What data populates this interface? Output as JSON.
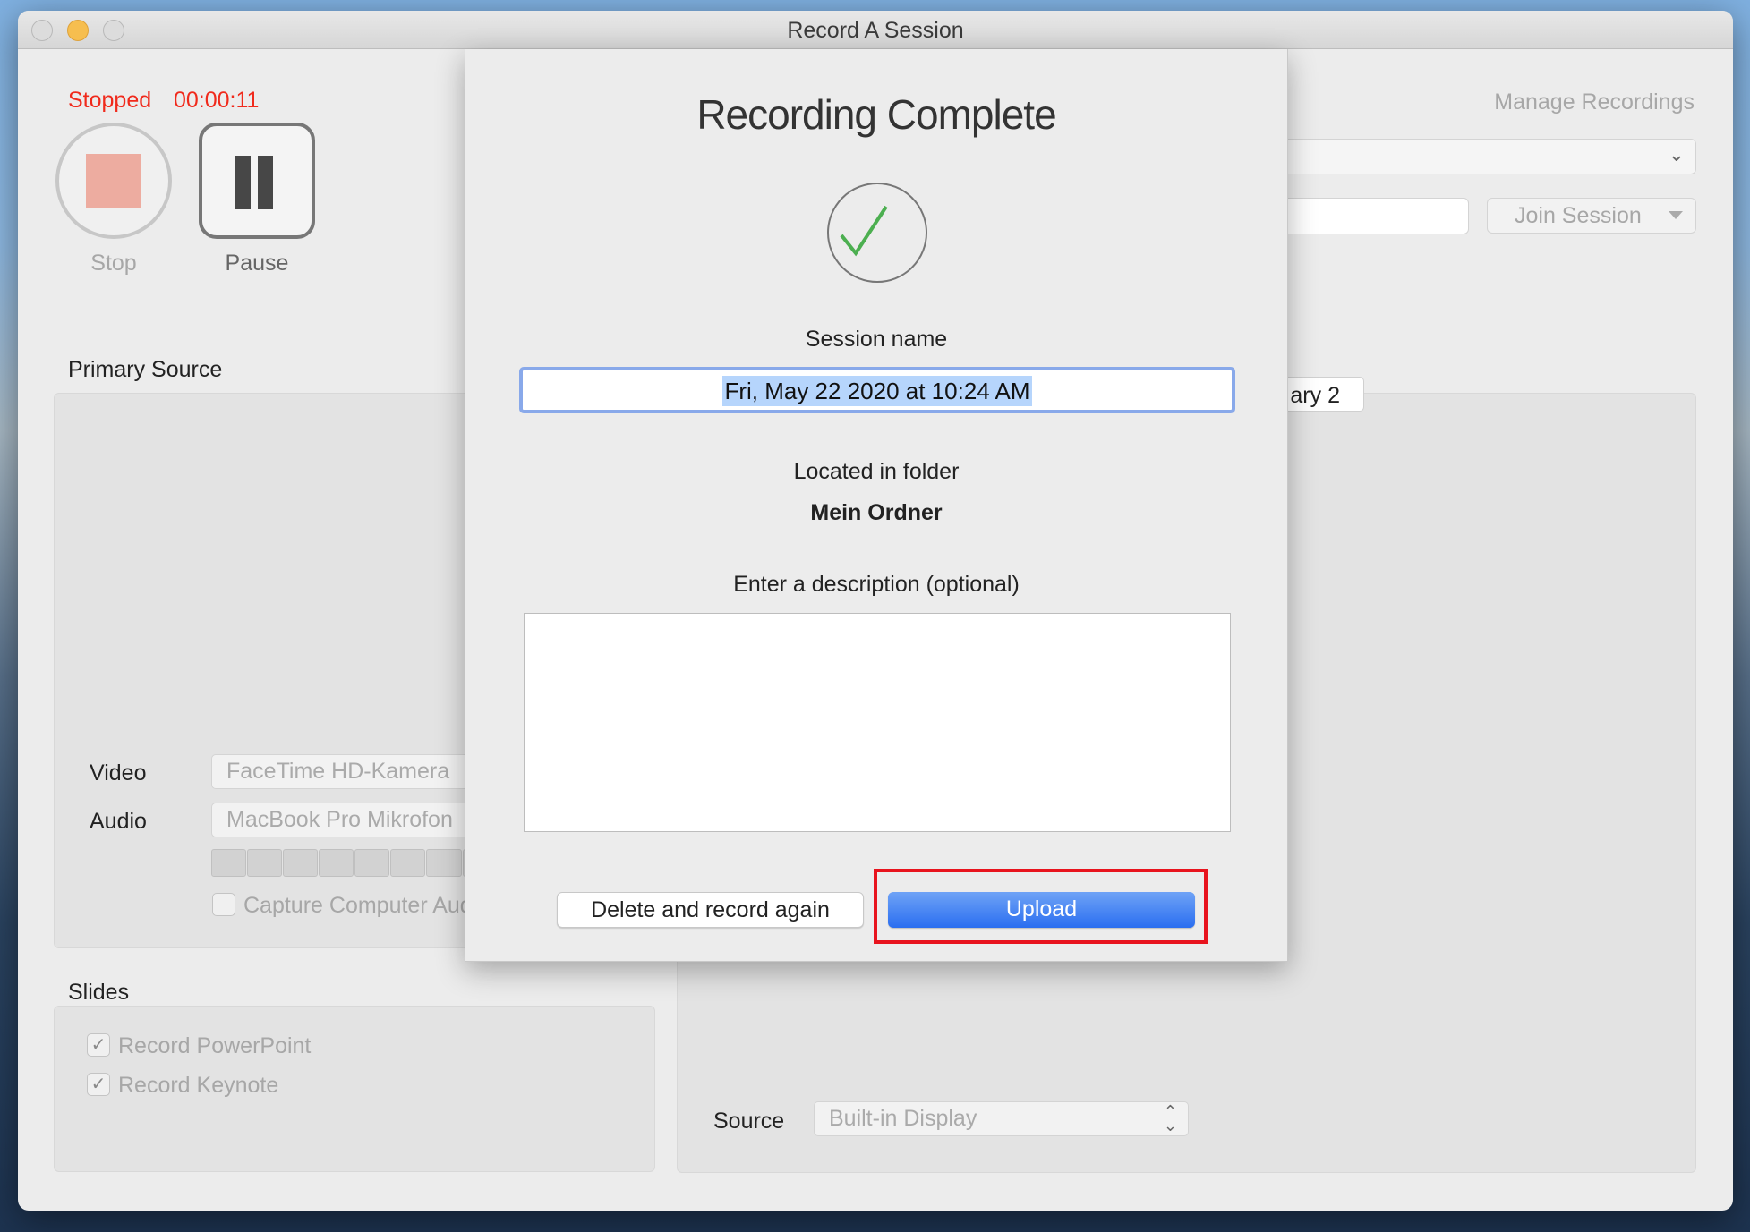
{
  "window": {
    "title": "Record A Session"
  },
  "status": {
    "state": "Stopped",
    "time": "00:00:11"
  },
  "controls": {
    "stop_label": "Stop",
    "pause_label": "Pause"
  },
  "primary_source": {
    "title": "Primary Source",
    "video_label": "Video",
    "video_value": "FaceTime HD-Kamera",
    "audio_label": "Audio",
    "audio_value": "MacBook Pro Mikrofon",
    "capture_label": "Capture Computer Audio",
    "capture_checked": false
  },
  "slides": {
    "title": "Slides",
    "items": [
      {
        "label": "Record PowerPoint",
        "checked": true
      },
      {
        "label": "Record Keynote",
        "checked": true
      }
    ]
  },
  "right": {
    "manage_recordings": "Manage Recordings",
    "join_session": "Join Session",
    "tab_label": "ary 2",
    "source_label": "Source",
    "source_value": "Built-in Display"
  },
  "dialog": {
    "title": "Recording Complete",
    "session_name_label": "Session name",
    "session_name_value": "Fri, May 22 2020 at 10:24 AM",
    "folder_label": "Located in folder",
    "folder_value": "Mein Ordner",
    "description_label": "Enter a description (optional)",
    "description_value": "",
    "delete_label": "Delete and record again",
    "upload_label": "Upload"
  },
  "colors": {
    "status": "#f02a1c",
    "accent": "#2f74f0",
    "check": "#4caf50",
    "highlight": "#e8141e"
  }
}
